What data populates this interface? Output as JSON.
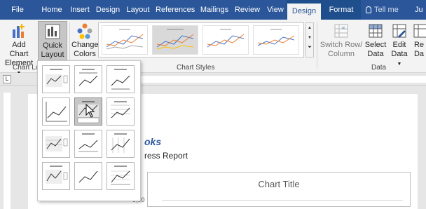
{
  "tabs": [
    {
      "label": "File",
      "active": false
    },
    {
      "label": "Home",
      "active": false
    },
    {
      "label": "Insert",
      "active": false
    },
    {
      "label": "Design",
      "active": false
    },
    {
      "label": "Layout",
      "active": false
    },
    {
      "label": "References",
      "active": false
    },
    {
      "label": "Mailings",
      "active": false
    },
    {
      "label": "Review",
      "active": false
    },
    {
      "label": "View",
      "active": false
    },
    {
      "label": "Design",
      "active": true
    },
    {
      "label": "Format",
      "active": false
    }
  ],
  "tell_me": "Tell me",
  "user_initials": "Ju",
  "ribbon": {
    "add_chart_element": {
      "line1": "Add Chart",
      "line2": "Element"
    },
    "quick_layout": {
      "line1": "Quick",
      "line2": "Layout"
    },
    "change_colors": {
      "line1": "Change",
      "line2": "Colors"
    },
    "switch_row_column": {
      "line1": "Switch Row/",
      "line2": "Column"
    },
    "select_data": {
      "line1": "Select",
      "line2": "Data"
    },
    "edit_data": {
      "line1": "Edit",
      "line2": "Data"
    },
    "refresh": {
      "line1": "Re",
      "line2": "Da"
    },
    "group_chart_layouts": "Chart La",
    "group_chart_styles": "Chart Styles",
    "group_data": "Data"
  },
  "document": {
    "heading_fragment": "oks",
    "sub_fragment": "ress Report",
    "chart_title": "Chart Title",
    "axis_tick": "9,00"
  },
  "colors": {
    "tab_bar": "#2b579a",
    "ribbon": "#f3f3f3",
    "accent": "#2b579a"
  },
  "quick_layout_items": 12,
  "hovered_layout_index": 4
}
